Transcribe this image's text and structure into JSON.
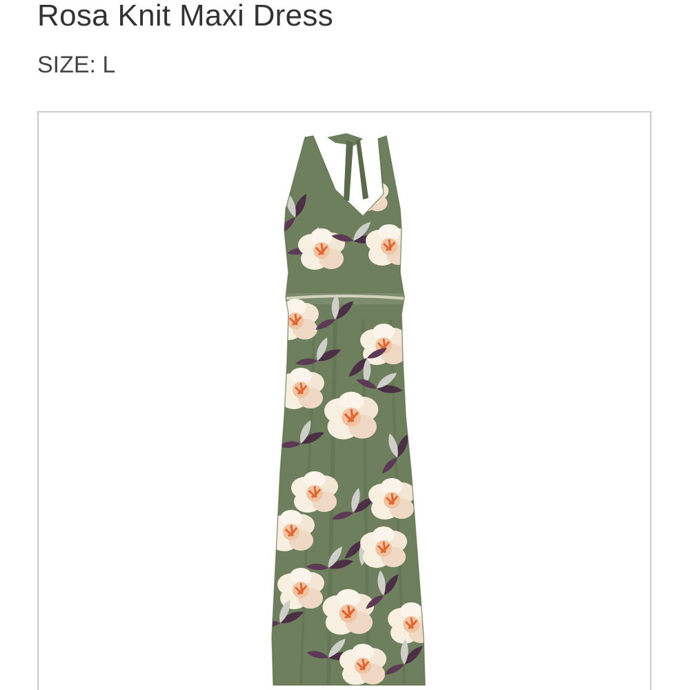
{
  "product": {
    "title": "Rosa Knit Maxi Dress",
    "size_label": "SIZE:",
    "size_value": "L"
  },
  "image": {
    "subject": "dress-photo",
    "colors": {
      "fabric": "#6d7f5c",
      "fabric_shadow": "#5a6b4b",
      "petal": "#f7efe0",
      "petal_shade": "#efd9c4",
      "center": "#e2672f",
      "leaf": "#4a2f45",
      "leaf_light": "#cfcfc9"
    }
  }
}
